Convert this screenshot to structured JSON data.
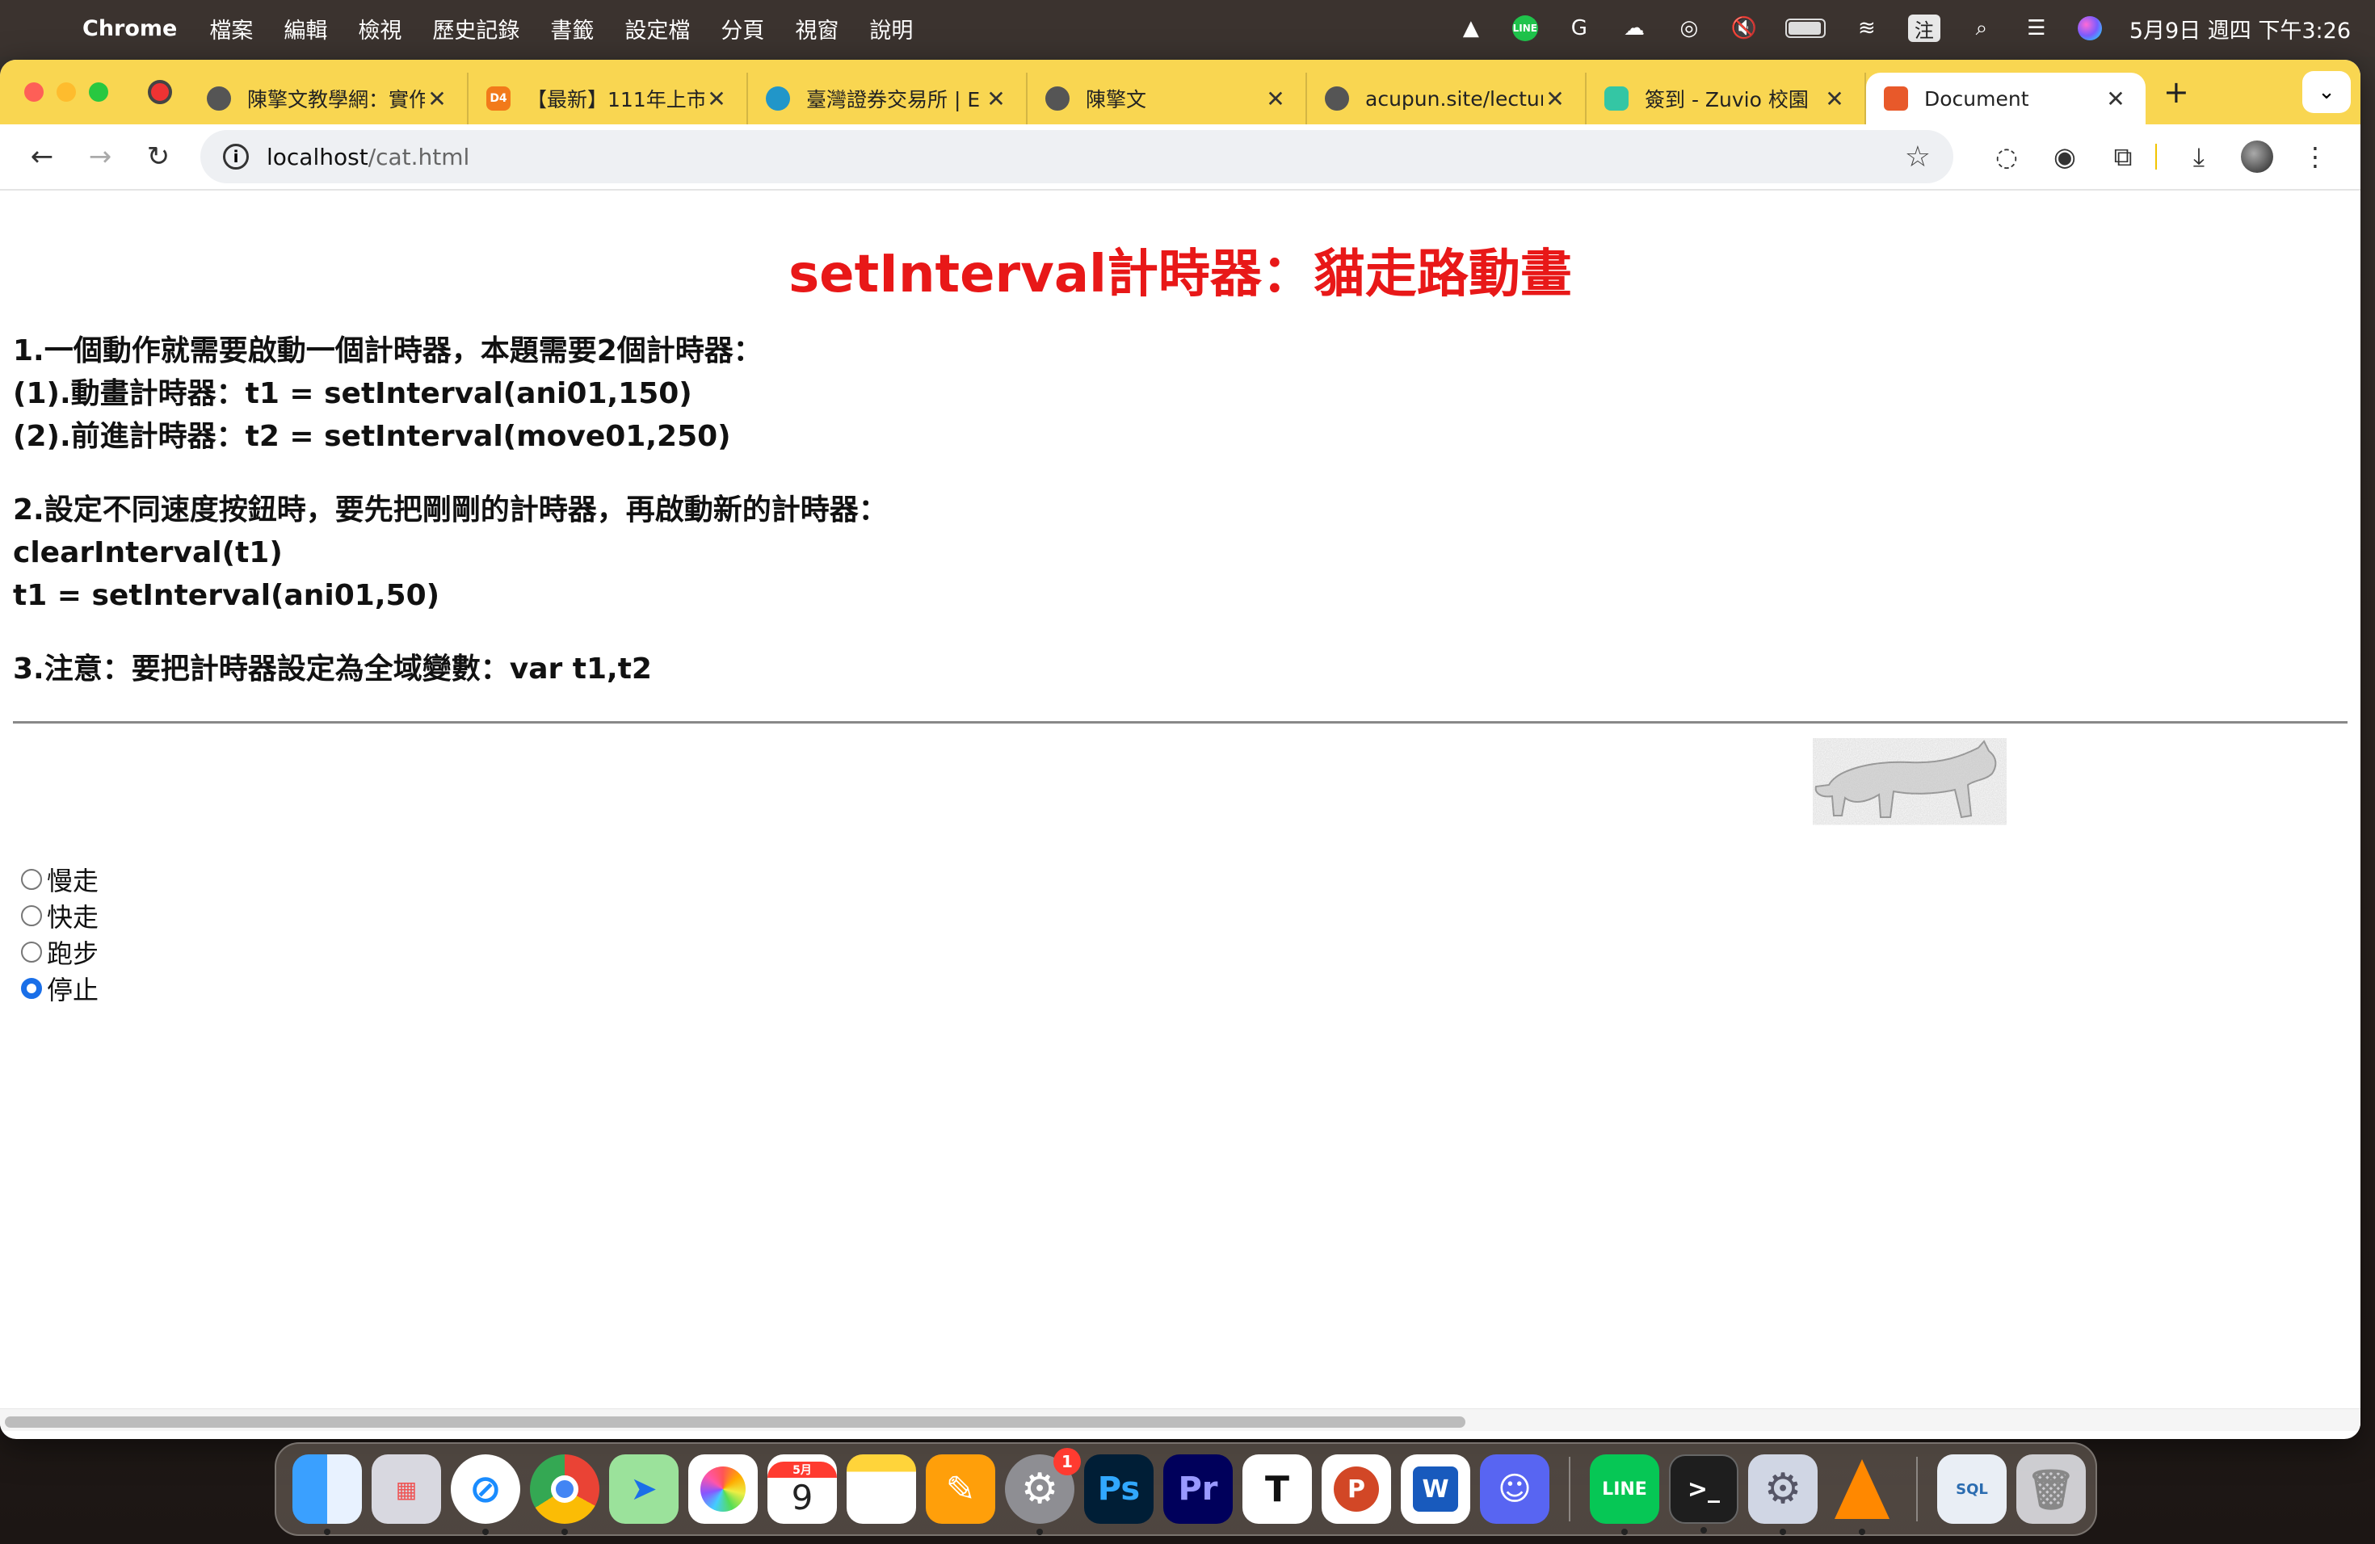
{
  "menubar": {
    "app": "Chrome",
    "menus": [
      "檔案",
      "編輯",
      "檢視",
      "歷史記錄",
      "書籤",
      "設定檔",
      "分頁",
      "視窗",
      "說明"
    ],
    "ime": "注",
    "clock": "5月9日 週四  下午3:26"
  },
  "tabs": [
    {
      "title": "陳擎文教學網：實作",
      "favicon": "globe-icon"
    },
    {
      "title": "【最新】111年上市",
      "favicon": "d4-icon"
    },
    {
      "title": "臺灣證券交易所 | E",
      "favicon": "twse-icon"
    },
    {
      "title": "陳擎文",
      "favicon": "globe-icon"
    },
    {
      "title": "acupun.site/lectur",
      "favicon": "globe-icon"
    },
    {
      "title": "簽到 - Zuvio 校園",
      "favicon": "zuvio-icon"
    },
    {
      "title": "Document",
      "favicon": "html-icon",
      "active": true
    }
  ],
  "toolbar": {
    "url_host": "localhost",
    "url_path": "/cat.html"
  },
  "page": {
    "title": "setInterval計時器：貓走路動畫",
    "section1": [
      "1.一個動作就需要啟動一個計時器，本題需要2個計時器：",
      "(1).動畫計時器：t1 = setInterval(ani01,150)",
      "(2).前進計時器：t2 = setInterval(move01,250)"
    ],
    "section2": [
      "2.設定不同速度按鈕時，要先把剛剛的計時器，再啟動新的計時器：",
      "clearInterval(t1)",
      "t1 = setInterval(ani01,50)"
    ],
    "section3": [
      "3.注意：要把計時器設定為全域變數：var t1,t2"
    ],
    "radios": [
      {
        "label": "慢走",
        "checked": false
      },
      {
        "label": "快走",
        "checked": false
      },
      {
        "label": "跑步",
        "checked": false
      },
      {
        "label": "停止",
        "checked": true
      }
    ]
  },
  "dock": {
    "calendar_month": "5月",
    "calendar_day": "9",
    "settings_badge": "1",
    "apps": [
      "Finder",
      "Launchpad",
      "Safari",
      "Chrome",
      "Maps",
      "Photos",
      "Calendar",
      "Notes",
      "Pages",
      "System Settings",
      "Photoshop",
      "Premiere Pro",
      "Typora",
      "PowerPoint",
      "Word",
      "Discord",
      "LINE",
      "Terminal",
      "System Preferences",
      "VLC",
      "MySQL Workbench",
      "Trash"
    ]
  },
  "colors": {
    "tabbar": "#f9d651",
    "title_red": "#e81818",
    "radio_accent": "#1a6fe8"
  }
}
